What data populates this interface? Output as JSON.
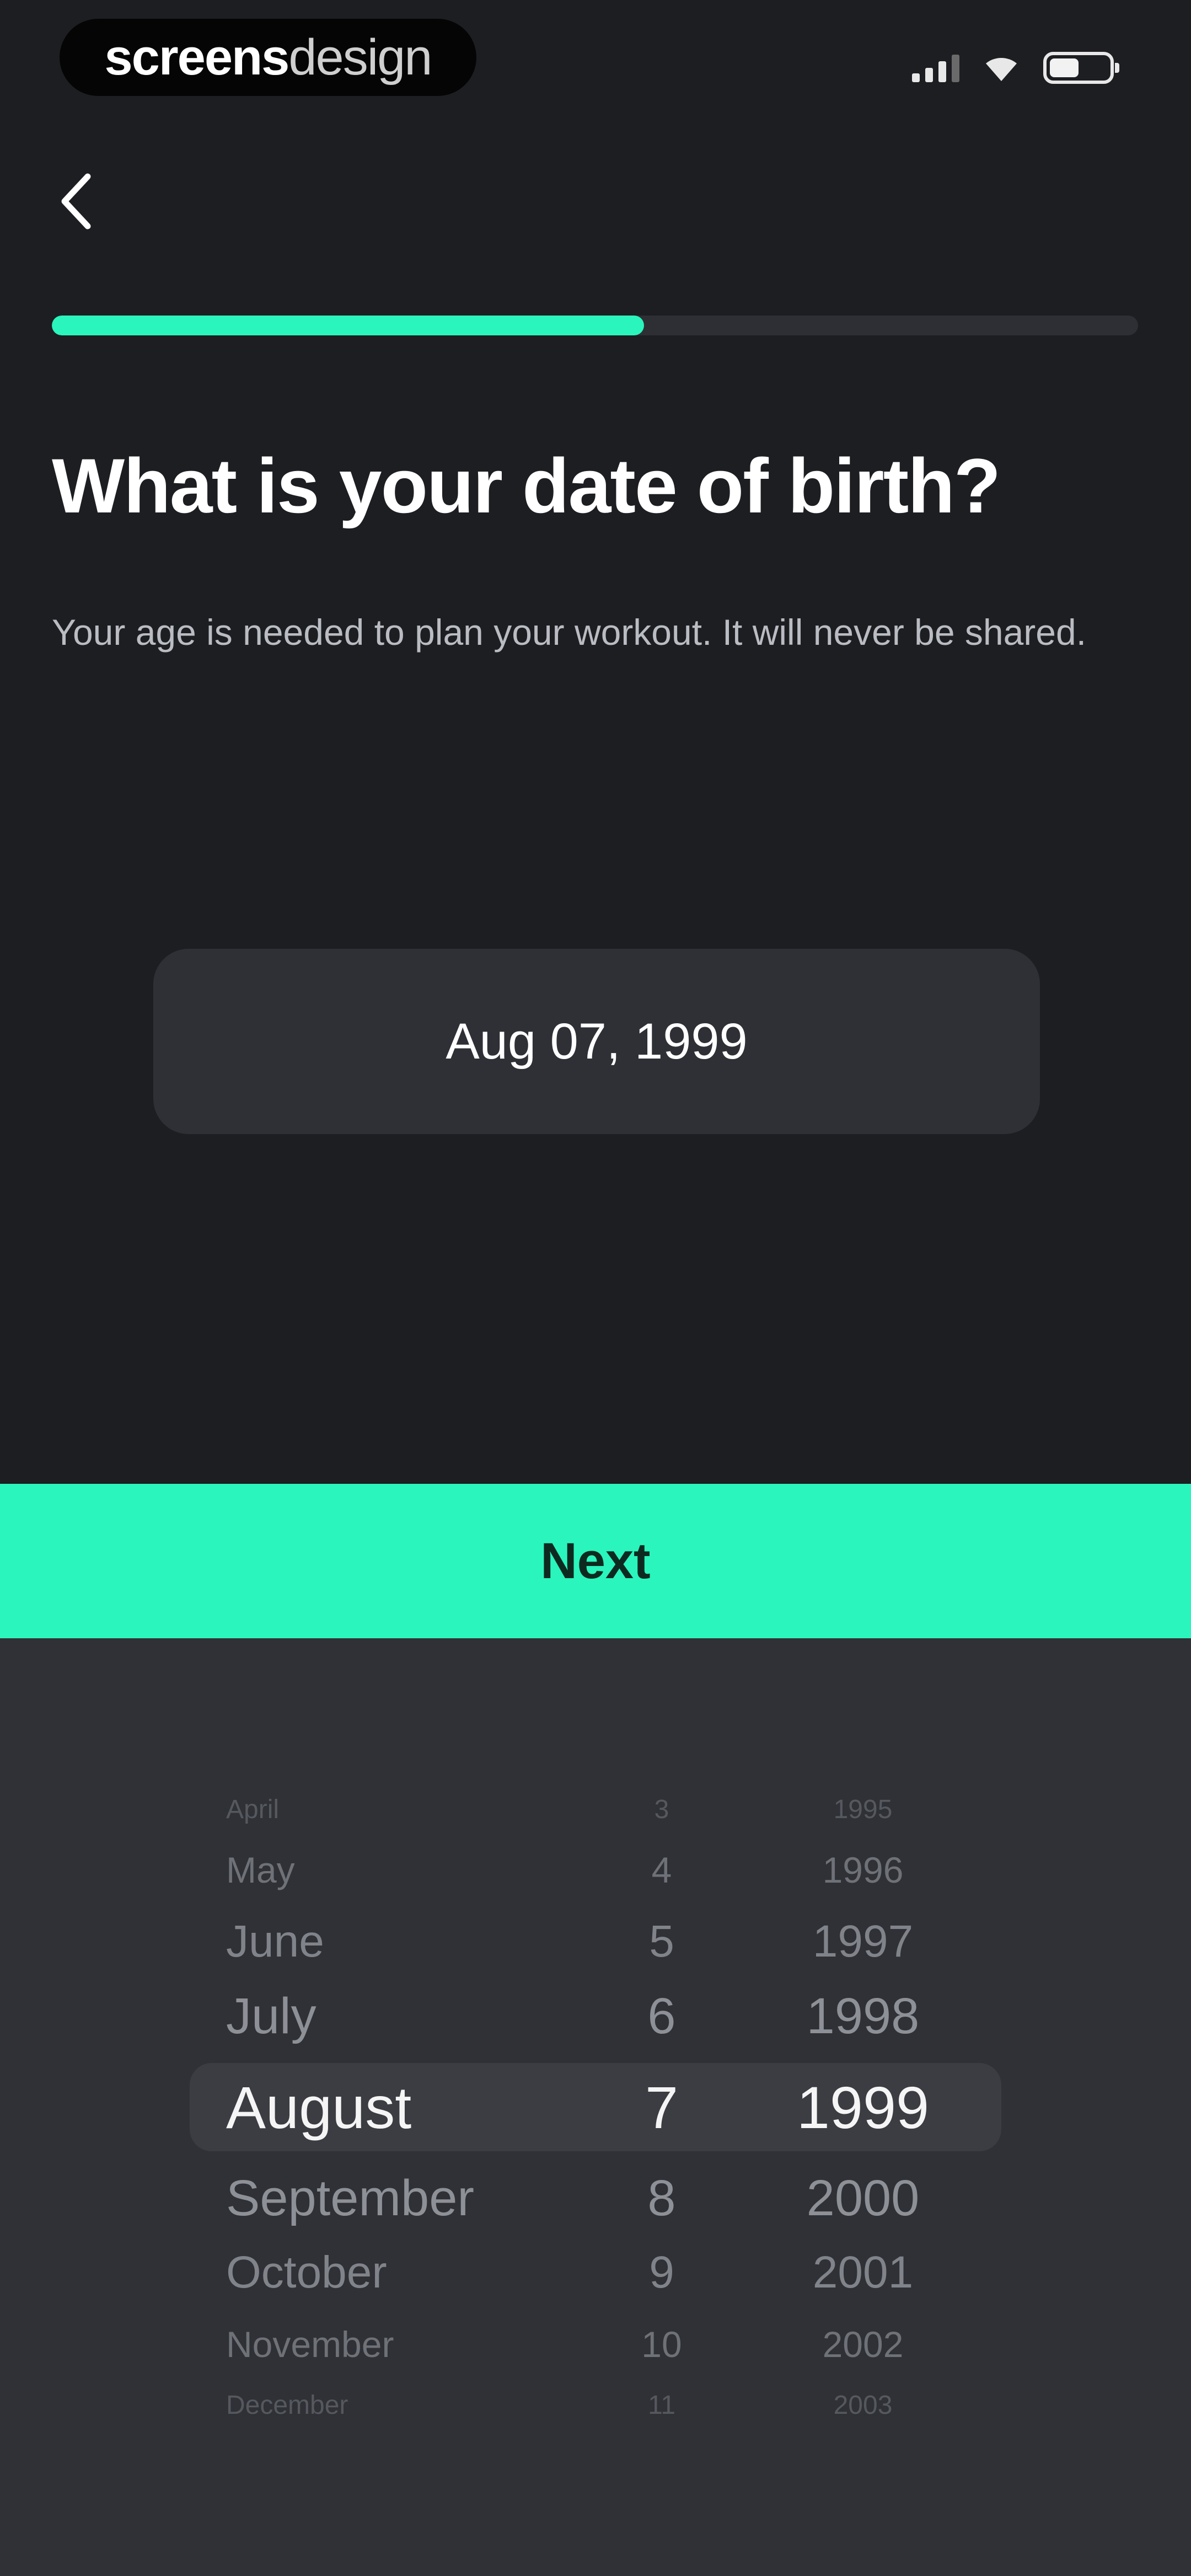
{
  "status_bar": {
    "brand_bold": "screens",
    "brand_light": "design"
  },
  "header": {
    "progress_percent": 54.5
  },
  "content": {
    "title": "What is your date of birth?",
    "subtitle": "Your age is needed to plan your workout. It will never be shared."
  },
  "date_field": {
    "value": "Aug 07, 1999"
  },
  "next_button": {
    "label": "Next"
  },
  "picker": {
    "rows": [
      {
        "month": "April",
        "day": "3",
        "year": "1995"
      },
      {
        "month": "May",
        "day": "4",
        "year": "1996"
      },
      {
        "month": "June",
        "day": "5",
        "year": "1997"
      },
      {
        "month": "July",
        "day": "6",
        "year": "1998"
      },
      {
        "month": "August",
        "day": "7",
        "year": "1999"
      },
      {
        "month": "September",
        "day": "8",
        "year": "2000"
      },
      {
        "month": "October",
        "day": "9",
        "year": "2001"
      },
      {
        "month": "November",
        "day": "10",
        "year": "2002"
      },
      {
        "month": "December",
        "day": "11",
        "year": "2003"
      }
    ]
  },
  "colors": {
    "accent": "#2af5bd",
    "background": "#1d1e22",
    "picker_background": "#2f3136",
    "field_background": "#2e3036"
  },
  "icons": {
    "back": "chevron-left-icon",
    "signal": "signal-icon",
    "wifi": "wifi-icon",
    "battery": "battery-icon"
  }
}
